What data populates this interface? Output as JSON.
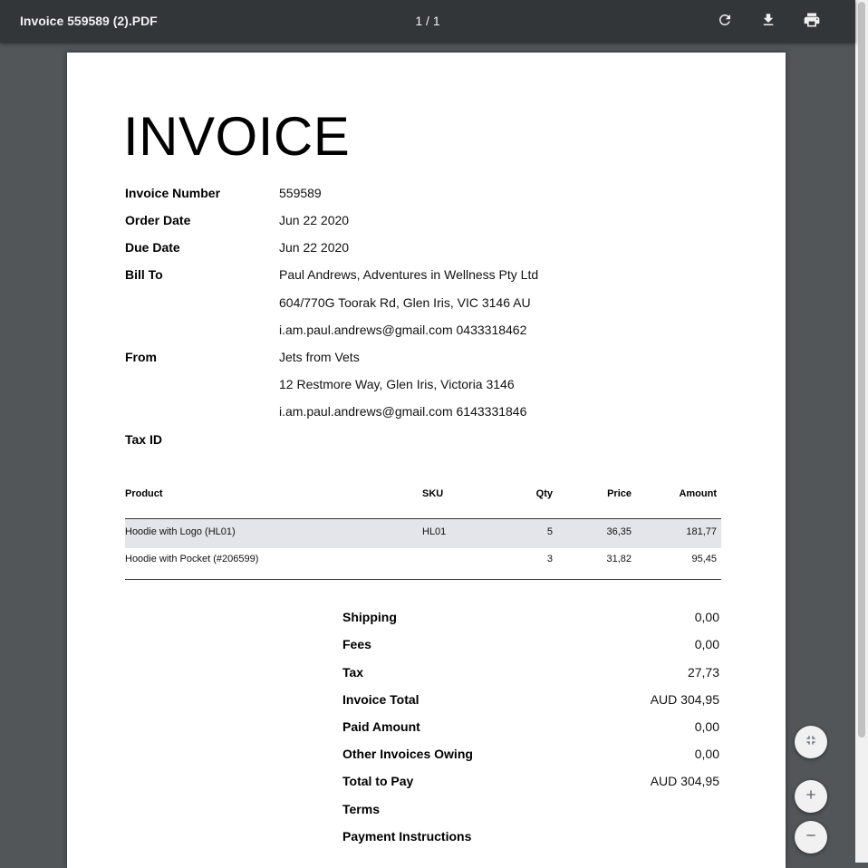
{
  "viewer": {
    "file_title": "Invoice 559589 (2).PDF",
    "page_indicator": "1 / 1",
    "icons": {
      "rotate": "rotate-icon",
      "download": "download-icon",
      "print": "print-icon",
      "fit": "fit-page-icon",
      "zoom_in": "zoom-in-icon",
      "zoom_out": "zoom-out-icon"
    }
  },
  "invoice": {
    "heading": "INVOICE",
    "fields": {
      "invoice_number": {
        "label": "Invoice Number",
        "value": "559589"
      },
      "order_date": {
        "label": "Order Date",
        "value": "Jun 22 2020"
      },
      "due_date": {
        "label": "Due Date",
        "value": "Jun 22 2020"
      },
      "bill_to": {
        "label": "Bill To",
        "lines": [
          "Paul Andrews, Adventures in Wellness Pty Ltd",
          "604/770G Toorak Rd, Glen Iris, VIC 3146 AU",
          "i.am.paul.andrews@gmail.com 0433318462"
        ]
      },
      "from": {
        "label": "From",
        "lines": [
          "Jets from Vets",
          "12 Restmore Way, Glen Iris, Victoria 3146",
          "i.am.paul.andrews@gmail.com 6143331846"
        ]
      },
      "tax_id": {
        "label": "Tax ID",
        "value": ""
      }
    },
    "table": {
      "headers": {
        "product": "Product",
        "sku": "SKU",
        "qty": "Qty",
        "price": "Price",
        "amount": "Amount"
      },
      "rows": [
        {
          "product": "Hoodie with Logo (HL01)",
          "sku": "HL01",
          "qty": "5",
          "price": "36,35",
          "amount": "181,77"
        },
        {
          "product": "Hoodie with Pocket (#206599)",
          "sku": "",
          "qty": "3",
          "price": "31,82",
          "amount": "95,45"
        }
      ]
    },
    "summary": {
      "shipping": {
        "label": "Shipping",
        "value": "0,00"
      },
      "fees": {
        "label": "Fees",
        "value": "0,00"
      },
      "tax": {
        "label": "Tax",
        "value": "27,73"
      },
      "invoice_total": {
        "label": "Invoice Total",
        "value": "AUD 304,95"
      },
      "paid_amount": {
        "label": "Paid Amount",
        "value": "0,00"
      },
      "other_owing": {
        "label": "Other Invoices Owing",
        "value": "0,00"
      },
      "total_to_pay": {
        "label": "Total to Pay",
        "value": "AUD 304,95"
      },
      "terms": {
        "label": "Terms",
        "value": ""
      },
      "payment_instructions": {
        "label": "Payment Instructions",
        "value": ""
      }
    }
  },
  "colors": {
    "toolbar": "#323639",
    "viewer_bg": "#525659",
    "row_highlight": "#e4e5ea"
  }
}
